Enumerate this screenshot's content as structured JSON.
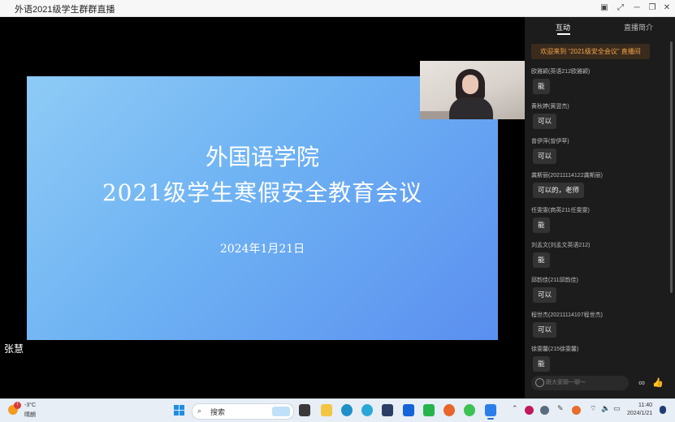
{
  "window": {
    "title": "外语2021级学生群群直播"
  },
  "slide": {
    "line1": "外国语学院",
    "line2": "2021级学生寒假安全教育会议",
    "date": "2024年1月21日"
  },
  "speaker_label": "张慧",
  "panel": {
    "tabs": [
      "互动",
      "直播简介"
    ],
    "welcome": "欢迎来到 “2021级安全会议” 直播间",
    "messages": [
      {
        "name": "欧雅颖(英语212欧雅颖)",
        "text": "能"
      },
      {
        "name": "黄秋婷(黄翌杰)",
        "text": "可以"
      },
      {
        "name": "曾伊萍(曾伊苹)",
        "text": "可以"
      },
      {
        "name": "龚斯丽(20211114122龚斯丽)",
        "text": "可以的，老师"
      },
      {
        "name": "任雯雯(商英211任雯雯)",
        "text": "能"
      },
      {
        "name": "刘孟文(刘孟文英语212)",
        "text": "能"
      },
      {
        "name": "邱韵佳(211邱韵佳)",
        "text": "可以"
      },
      {
        "name": "程世杰(20211114107程世杰)",
        "text": "可以"
      },
      {
        "name": "徐雯馨(215徐雯馨)",
        "text": "能"
      }
    ],
    "input_placeholder": "跟大家聊一聊～"
  },
  "taskbar": {
    "weather_temp": "-3°C",
    "weather_desc": "晴朗",
    "weather_badge": "!",
    "search_placeholder": "搜索",
    "time": "11:40",
    "date": "2024/1/21"
  },
  "colors": {
    "accent_orange": "#f2a44a",
    "panel_bg": "#1c1c1c",
    "slide_gradient_start": "#8ecbf6",
    "slide_gradient_end": "#5b8ff0"
  }
}
